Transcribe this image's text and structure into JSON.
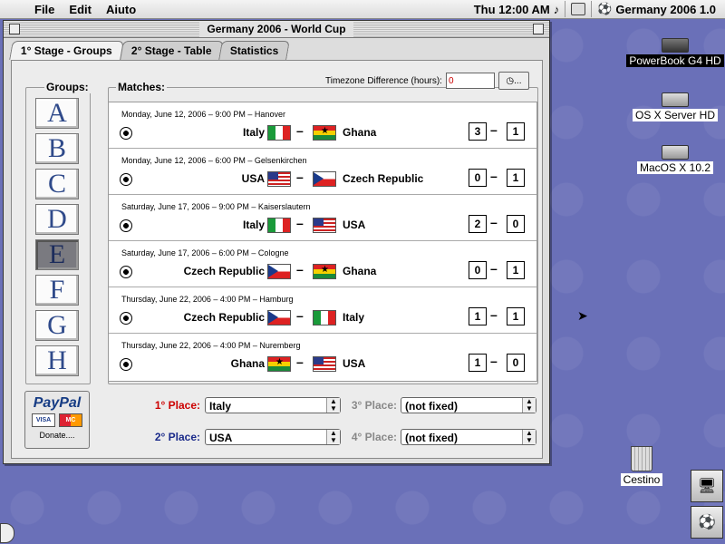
{
  "menubar": {
    "apple_icon": "apple-icon",
    "menus": [
      "File",
      "Edit",
      "Aiuto"
    ],
    "clock": "Thu 12:00 AM",
    "app_name": "Germany 2006 1.0"
  },
  "window": {
    "title": "Germany 2006 - World Cup",
    "tabs": [
      "1° Stage - Groups",
      "2° Stage - Table",
      "Statistics"
    ],
    "active_tab": 0
  },
  "groups": {
    "label": "Groups:",
    "items": [
      "A",
      "B",
      "C",
      "D",
      "E",
      "F",
      "G",
      "H"
    ],
    "selected": "E"
  },
  "matches": {
    "label": "Matches:",
    "timezone_label": "Timezone Difference (hours):",
    "timezone_value": "0",
    "timezone_button": "...",
    "list": [
      {
        "info": "Monday, June 12, 2006 – 9:00 PM – Hanover",
        "home": "Italy",
        "home_flag": "italy",
        "away": "Ghana",
        "away_flag": "ghana",
        "home_score": "3",
        "away_score": "1"
      },
      {
        "info": "Monday, June 12, 2006 – 6:00 PM – Gelsenkirchen",
        "home": "USA",
        "home_flag": "usa",
        "away": "Czech Republic",
        "away_flag": "czech",
        "home_score": "0",
        "away_score": "1"
      },
      {
        "info": "Saturday, June 17, 2006 – 9:00 PM – Kaiserslautern",
        "home": "Italy",
        "home_flag": "italy",
        "away": "USA",
        "away_flag": "usa",
        "home_score": "2",
        "away_score": "0"
      },
      {
        "info": "Saturday, June 17, 2006 – 6:00 PM – Cologne",
        "home": "Czech Republic",
        "home_flag": "czech",
        "away": "Ghana",
        "away_flag": "ghana",
        "home_score": "0",
        "away_score": "1"
      },
      {
        "info": "Thursday, June 22, 2006 – 4:00 PM – Hamburg",
        "home": "Czech Republic",
        "home_flag": "czech",
        "away": "Italy",
        "away_flag": "italy",
        "home_score": "1",
        "away_score": "1"
      },
      {
        "info": "Thursday, June 22, 2006 – 4:00 PM – Nuremberg",
        "home": "Ghana",
        "home_flag": "ghana",
        "away": "USA",
        "away_flag": "usa",
        "home_score": "1",
        "away_score": "0"
      }
    ]
  },
  "places": {
    "first": {
      "label": "1° Place:",
      "value": "Italy"
    },
    "second": {
      "label": "2° Place:",
      "value": "USA"
    },
    "third": {
      "label": "3° Place:",
      "value": "(not fixed)"
    },
    "fourth": {
      "label": "4° Place:",
      "value": "(not fixed)"
    }
  },
  "donate": {
    "logo": "PayPal",
    "visa": "VISA",
    "mastercard": "MC",
    "label": "Donate...."
  },
  "desktop": {
    "icons": [
      "PowerBook G4 HD",
      "OS X Server HD",
      "MacOS X 10.2"
    ],
    "trash": "Cestino"
  }
}
